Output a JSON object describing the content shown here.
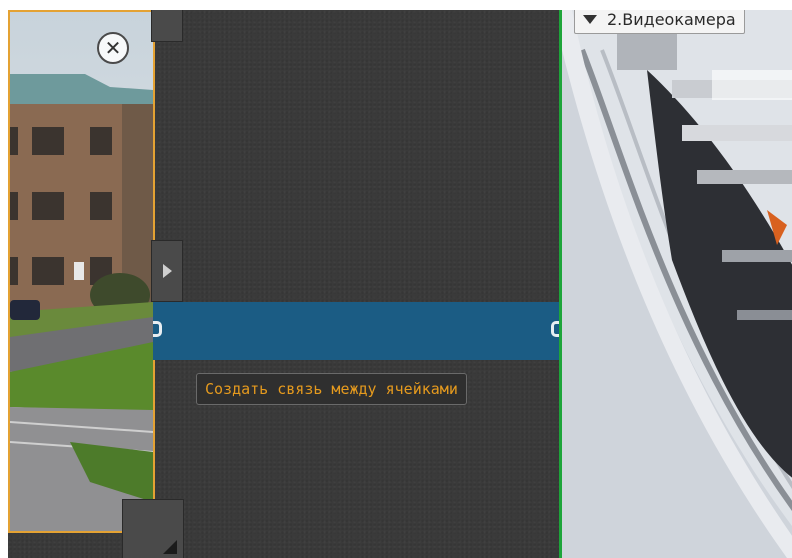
{
  "left_camera": {
    "close_icon": "close-icon"
  },
  "link_bar": {
    "tooltip": "Создать связь между ячейками"
  },
  "right_camera": {
    "title": "2.Видеокамера",
    "dropdown_icon": "chevron-down-icon"
  },
  "colors": {
    "selected_border": "#e4a233",
    "link_bar": "#1b5c84",
    "tooltip_text": "#e59a1e",
    "active_border": "#1ea53a"
  }
}
